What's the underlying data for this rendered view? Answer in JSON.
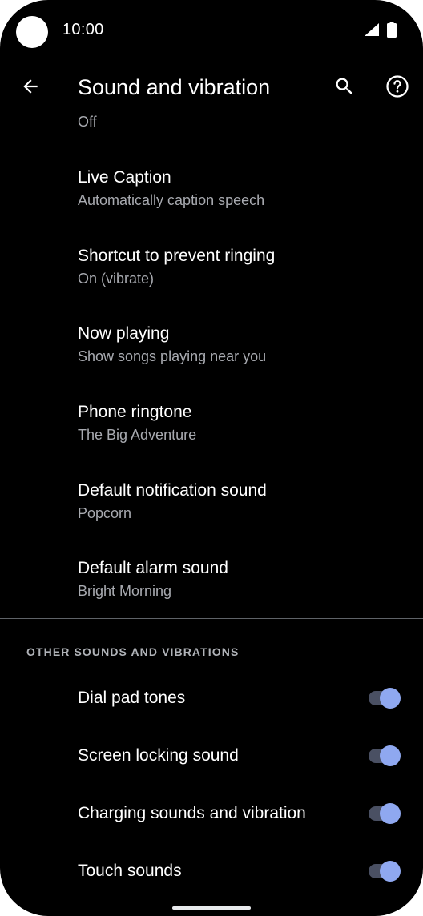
{
  "status_bar": {
    "time": "10:00"
  },
  "app_bar": {
    "title": "Sound and vibration",
    "back_icon": "arrow-back-icon",
    "search_icon": "search-icon",
    "help_icon": "help-icon"
  },
  "partial_item_summary": "Off",
  "preferences": [
    {
      "title": "Live Caption",
      "summary": "Automatically caption speech"
    },
    {
      "title": "Shortcut to prevent ringing",
      "summary": "On (vibrate)"
    },
    {
      "title": "Now playing",
      "summary": "Show songs playing near you"
    },
    {
      "title": "Phone ringtone",
      "summary": "The Big Adventure"
    },
    {
      "title": "Default notification sound",
      "summary": "Popcorn"
    },
    {
      "title": "Default alarm sound",
      "summary": "Bright Morning"
    }
  ],
  "other_section": {
    "header": "OTHER SOUNDS AND VIBRATIONS",
    "switches": [
      {
        "label": "Dial pad tones",
        "on": true
      },
      {
        "label": "Screen locking sound",
        "on": true
      },
      {
        "label": "Charging sounds and vibration",
        "on": true
      },
      {
        "label": "Touch sounds",
        "on": true
      }
    ]
  },
  "colors": {
    "background": "#000000",
    "accent_thumb": "#8fa8f0",
    "track": "#4a5063",
    "secondary_text": "#a8aab0"
  }
}
